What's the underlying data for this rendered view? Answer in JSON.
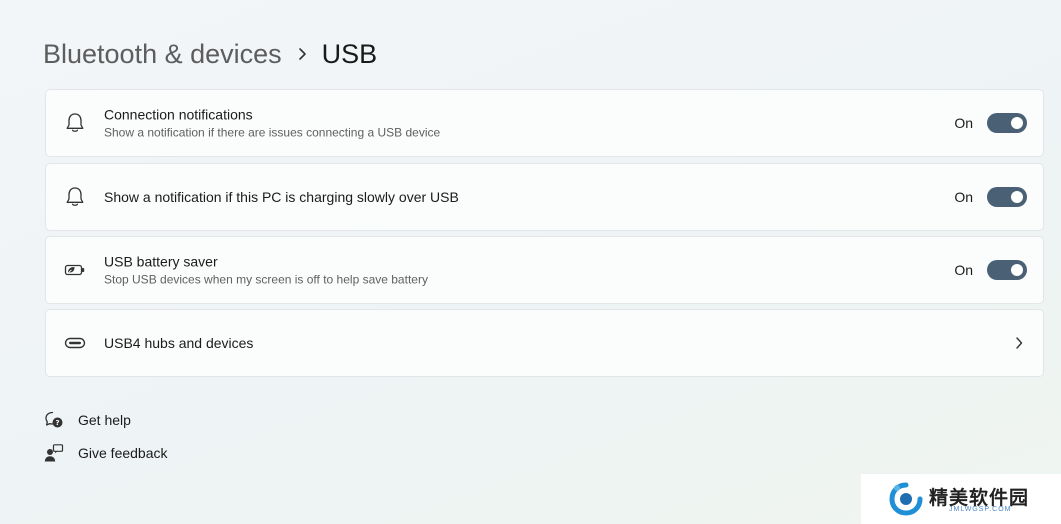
{
  "breadcrumb": {
    "parent": "Bluetooth & devices",
    "separator_icon": "chevron-right-icon",
    "current": "USB"
  },
  "settings": [
    {
      "icon": "bell-icon",
      "title": "Connection notifications",
      "subtitle": "Show a notification if there are issues connecting a USB device",
      "toggle_label": "On",
      "toggle_on": true
    },
    {
      "icon": "bell-icon",
      "title": "Show a notification if this PC is charging slowly over USB",
      "toggle_label": "On",
      "toggle_on": true
    },
    {
      "icon": "battery-saver-icon",
      "title": "USB battery saver",
      "subtitle": "Stop USB devices when my screen is off to help save battery",
      "toggle_label": "On",
      "toggle_on": true
    },
    {
      "icon": "usb-c-port-icon",
      "title": "USB4 hubs and devices",
      "action_icon": "chevron-right-icon"
    }
  ],
  "help": {
    "get_help": "Get help",
    "give_feedback": "Give feedback"
  },
  "watermark": {
    "title": "精美软件园",
    "subtitle": "JMLWGSP.COM"
  },
  "colors": {
    "toggle_on": "#4a6074",
    "card_bg": "#fbfcfc",
    "card_border": "#e3e6e8"
  }
}
